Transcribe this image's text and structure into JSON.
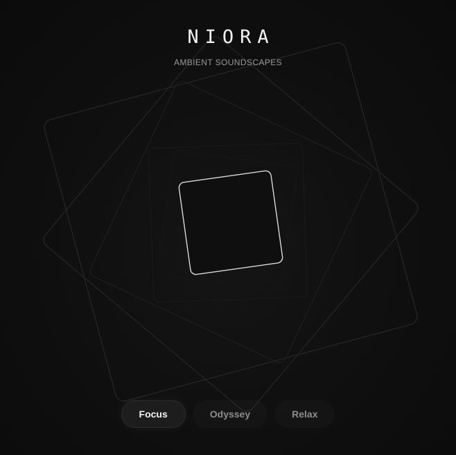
{
  "header": {
    "title": "NIORA",
    "subtitle": "AMBIENT SOUNDSCAPES"
  },
  "visualizer": {
    "shape_names": [
      "outer-square-a",
      "outer-square-b",
      "mid-square-a",
      "mid-square-b",
      "inner-square-faint",
      "center-square"
    ],
    "accent_color": "#d9d9d9",
    "faint_color": "#2a2a2a"
  },
  "modes": {
    "active": "Focus",
    "tabs": [
      {
        "label": "Focus"
      },
      {
        "label": "Odyssey"
      },
      {
        "label": "Relax"
      }
    ]
  }
}
